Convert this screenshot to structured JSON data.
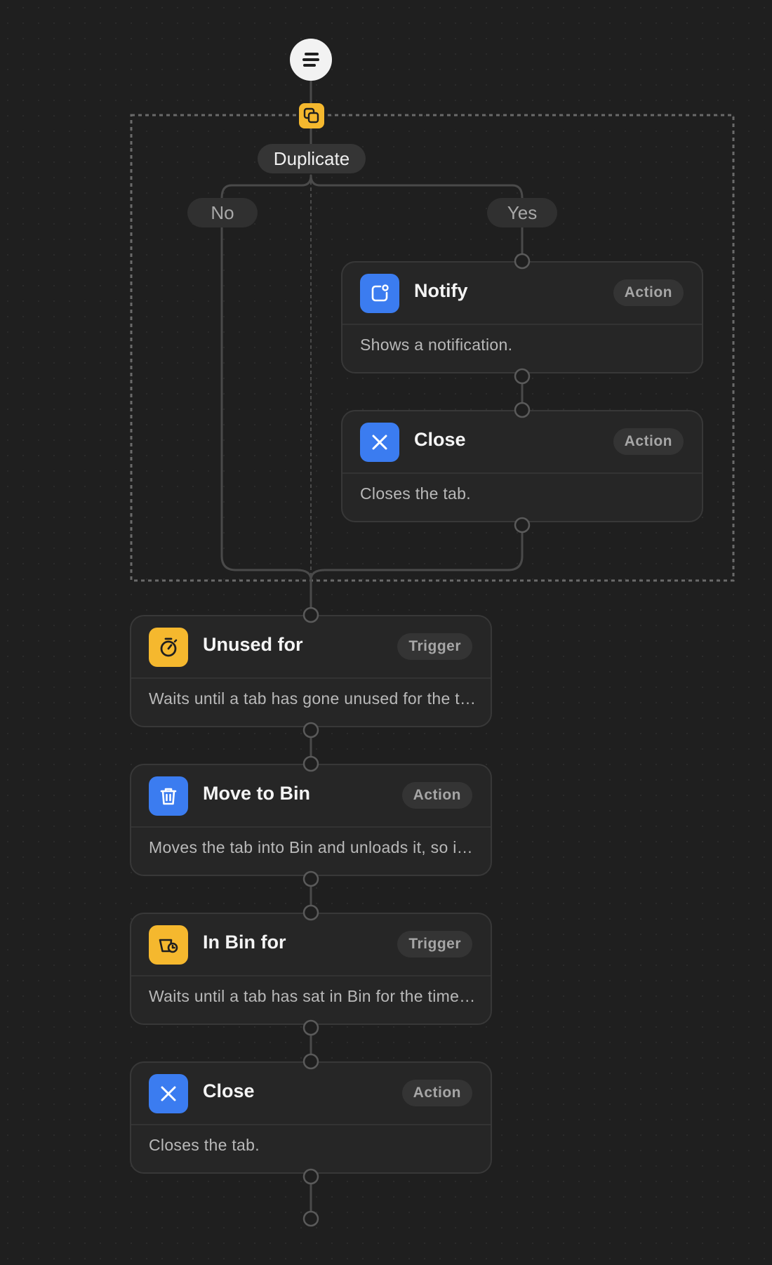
{
  "colors": {
    "background": "#1f1f1f",
    "action_blue": "#3b7cf0",
    "trigger_yellow": "#f5b82e",
    "card_bg": "#262626",
    "wire": "#4a4a4a"
  },
  "start_node": {
    "icon": "lines-icon"
  },
  "condition": {
    "icon": "duplicate-icon",
    "label": "Duplicate",
    "branch_no": "No",
    "branch_yes": "Yes"
  },
  "yes_branch": [
    {
      "icon": "notification-icon",
      "title": "Notify",
      "badge": "Action",
      "description": "Shows a notification."
    },
    {
      "icon": "close-icon",
      "title": "Close",
      "badge": "Action",
      "description": "Closes the tab."
    }
  ],
  "steps": [
    {
      "icon": "stopwatch-icon",
      "title": "Unused for",
      "badge": "Trigger",
      "description": "Waits until a tab has gone unused for the time set."
    },
    {
      "icon": "trash-icon",
      "title": "Move to Bin",
      "badge": "Action",
      "description": "Moves the tab into Bin and unloads it, so it uses no memory."
    },
    {
      "icon": "bin-timer-icon",
      "title": "In Bin for",
      "badge": "Trigger",
      "description": "Waits until a tab has sat in Bin for the time set."
    },
    {
      "icon": "close-icon",
      "title": "Close",
      "badge": "Action",
      "description": "Closes the tab."
    }
  ]
}
